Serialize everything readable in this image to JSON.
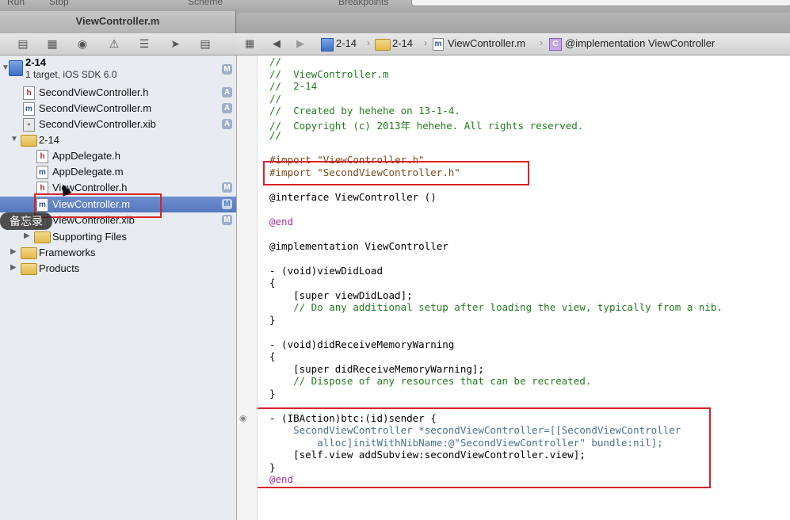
{
  "toolbar": {
    "run": "Run",
    "stop": "Stop",
    "scheme": "Scheme",
    "breakpoints": "Breakpoints"
  },
  "tab": {
    "title": "ViewController.m"
  },
  "navigator": {
    "project": {
      "name": "2-14",
      "subtitle": "1 target, iOS SDK 6.0",
      "badge": "M"
    },
    "items": [
      {
        "name": "SecondViewController.h",
        "icon": "h",
        "badge": "A"
      },
      {
        "name": "SecondViewController.m",
        "icon": "m",
        "badge": "A"
      },
      {
        "name": "SecondViewController.xib",
        "icon": "xib",
        "badge": "A"
      },
      {
        "name": "2-14",
        "icon": "folder",
        "badge": ""
      },
      {
        "name": "AppDelegate.h",
        "icon": "h",
        "badge": ""
      },
      {
        "name": "AppDelegate.m",
        "icon": "m",
        "badge": ""
      },
      {
        "name": "ViewController.h",
        "icon": "h",
        "badge": "M"
      },
      {
        "name": "ViewController.m",
        "icon": "m",
        "badge": "M",
        "selected": true
      },
      {
        "name": "ViewController.xib",
        "icon": "xib",
        "badge": "M"
      },
      {
        "name": "Supporting Files",
        "icon": "folder",
        "badge": ""
      },
      {
        "name": "Frameworks",
        "icon": "folder",
        "badge": ""
      },
      {
        "name": "Products",
        "icon": "folder",
        "badge": ""
      }
    ],
    "tooltip": "备忘录"
  },
  "jumpbar": {
    "crumbs": [
      "2-14",
      "2-14",
      "ViewController.m",
      "@implementation ViewController"
    ]
  },
  "code": {
    "lines": [
      "//",
      "//  ViewController.m",
      "//  2-14",
      "//",
      "//  Created by hehehe on 13-1-4.",
      "//  Copyright (c) 2013年 hehehe. All rights reserved.",
      "//",
      "",
      "#import \"ViewController.h\"",
      "#import \"SecondViewController.h\"",
      "",
      "@interface ViewController ()",
      "",
      "@end",
      "",
      "@implementation ViewController",
      "",
      "- (void)viewDidLoad",
      "{",
      "    [super viewDidLoad];",
      "    // Do any additional setup after loading the view, typically from a nib.",
      "}",
      "",
      "- (void)didReceiveMemoryWarning",
      "{",
      "    [super didReceiveMemoryWarning];",
      "    // Dispose of any resources that can be recreated.",
      "}",
      "",
      "- (IBAction)btc:(id)sender {",
      "    SecondViewController *secondViewController=[[SecondViewController",
      "        alloc]initWithNibName:@\"SecondViewController\" bundle:nil];",
      "    [self.view addSubview:secondViewController.view];",
      "}",
      "@end"
    ]
  },
  "colors": {
    "highlight": "#d8222a",
    "selection": "#5577bd",
    "comment": "#237a1f",
    "keyword": "#a8349a",
    "string": "#c5161d"
  }
}
